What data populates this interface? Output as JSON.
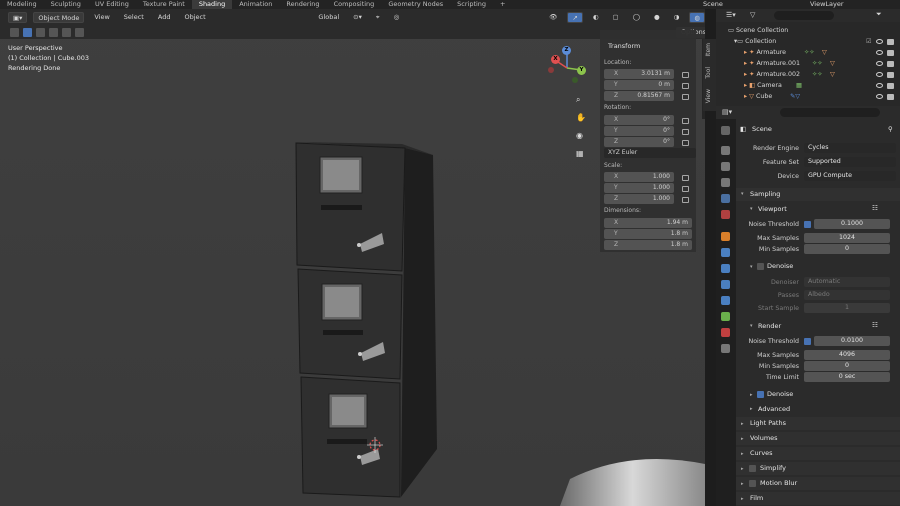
{
  "workspaces": [
    "Modeling",
    "Sculpting",
    "UV Editing",
    "Texture Paint",
    "Shading",
    "Animation",
    "Rendering",
    "Compositing",
    "Geometry Nodes",
    "Scripting",
    "+"
  ],
  "scene_name": "Scene",
  "view_layer": "ViewLayer",
  "viewport": {
    "mode": "Object Mode",
    "menus": [
      "View",
      "Select",
      "Add",
      "Object"
    ],
    "orientation": "Global",
    "options": "Options",
    "info": {
      "perspective": "User Perspective",
      "collection": "(1) Collection | Cube.003",
      "status": "Rendering Done"
    }
  },
  "npanel": {
    "tabs": [
      "Item",
      "Tool",
      "View"
    ],
    "header": "Transform",
    "location_label": "Location:",
    "location": [
      {
        "axis": "X",
        "value": "3.0131 m"
      },
      {
        "axis": "Y",
        "value": "0 m"
      },
      {
        "axis": "Z",
        "value": "0.81567 m"
      }
    ],
    "rotation_label": "Rotation:",
    "rotation": [
      {
        "axis": "X",
        "value": "0°"
      },
      {
        "axis": "Y",
        "value": "0°"
      },
      {
        "axis": "Z",
        "value": "0°"
      }
    ],
    "euler": "XYZ Euler",
    "scale_label": "Scale:",
    "scale": [
      {
        "axis": "X",
        "value": "1.000"
      },
      {
        "axis": "Y",
        "value": "1.000"
      },
      {
        "axis": "Z",
        "value": "1.000"
      }
    ],
    "dimensions_label": "Dimensions:",
    "dimensions": [
      {
        "axis": "X",
        "value": "1.94 m"
      },
      {
        "axis": "Y",
        "value": "1.8 m"
      },
      {
        "axis": "Z",
        "value": "1.8 m"
      }
    ]
  },
  "gizmo": {
    "x": "X",
    "y": "Y",
    "z": "Z"
  },
  "outliner": {
    "root": "Scene Collection",
    "collection": "Collection",
    "items": [
      "Armature",
      "Armature.001",
      "Armature.002",
      "Camera",
      "Cube"
    ]
  },
  "properties": {
    "context": "Scene",
    "render_engine_label": "Render Engine",
    "render_engine": "Cycles",
    "feature_set_label": "Feature Set",
    "feature_set": "Supported",
    "device_label": "Device",
    "device": "GPU Compute",
    "sampling": "Sampling",
    "viewport_sub": "Viewport",
    "vp_noise_label": "Noise Threshold",
    "vp_noise": "0.1000",
    "vp_max_label": "Max Samples",
    "vp_max": "1024",
    "vp_min_label": "Min Samples",
    "vp_min": "0",
    "vp_denoise": "Denoise",
    "vp_denoiser_label": "Denoiser",
    "vp_denoiser": "Automatic",
    "vp_passes_label": "Passes",
    "vp_passes": "Albedo",
    "vp_start_label": "Start Sample",
    "vp_start": "1",
    "render_sub": "Render",
    "r_noise_label": "Noise Threshold",
    "r_noise": "0.0100",
    "r_max_label": "Max Samples",
    "r_max": "4096",
    "r_min_label": "Min Samples",
    "r_min": "0",
    "r_time_label": "Time Limit",
    "r_time": "0 sec",
    "r_denoise": "Denoise",
    "advanced": "Advanced",
    "panels": [
      "Light Paths",
      "Volumes",
      "Curves",
      "Simplify",
      "Motion Blur",
      "Film"
    ]
  }
}
